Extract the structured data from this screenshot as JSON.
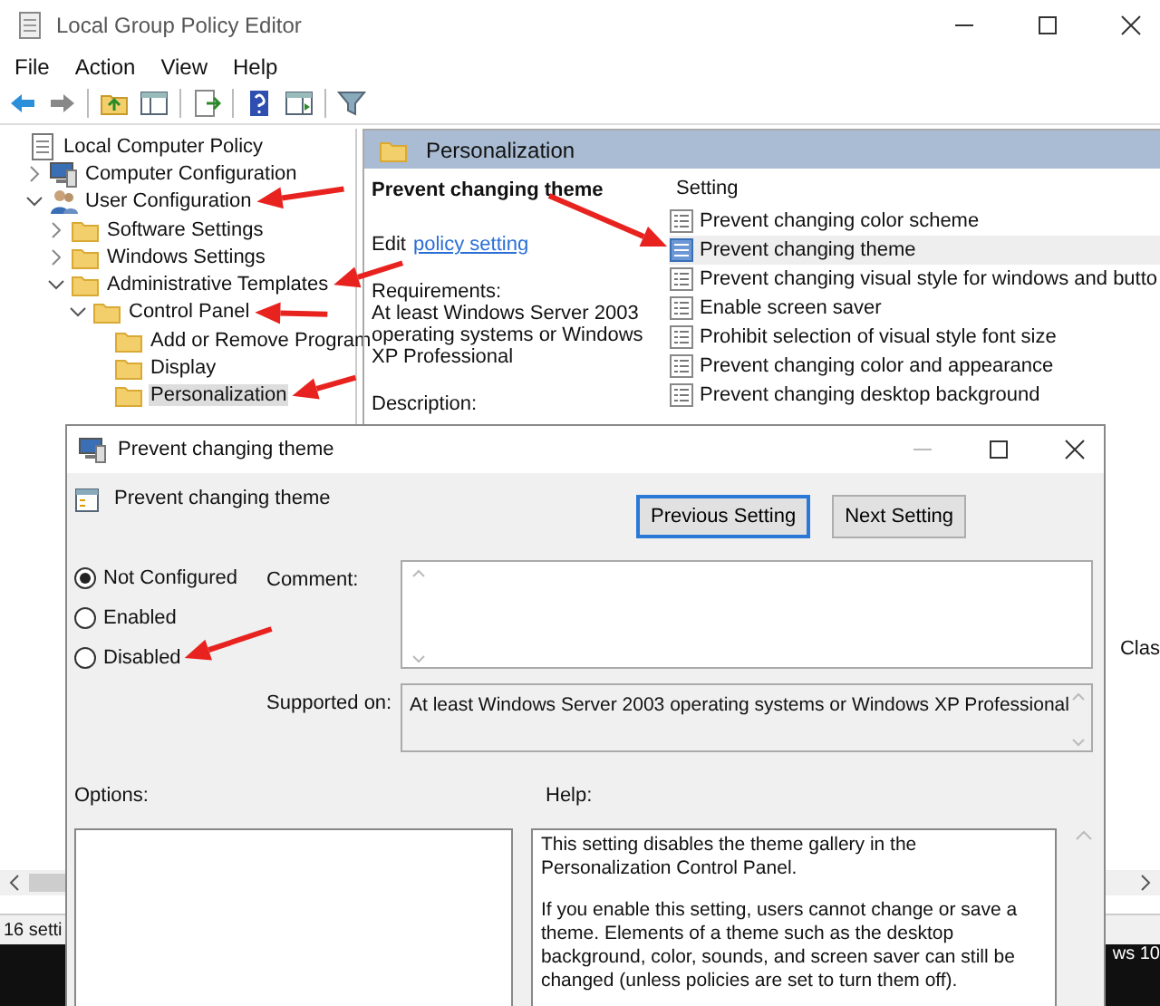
{
  "window": {
    "title": "Local Group Policy Editor"
  },
  "menu": [
    "File",
    "Action",
    "View",
    "Help"
  ],
  "tree": [
    {
      "label": "Local Computer Policy",
      "kind": "policy",
      "selected": false,
      "children": [
        {
          "label": "Computer Configuration",
          "kind": "computer",
          "expanded": false,
          "selected": false
        },
        {
          "label": "User Configuration",
          "kind": "user",
          "expanded": true,
          "selected": false,
          "children": [
            {
              "label": "Software Settings",
              "kind": "folder",
              "expanded": false,
              "selected": false
            },
            {
              "label": "Windows Settings",
              "kind": "folder",
              "expanded": false,
              "selected": false
            },
            {
              "label": "Administrative Templates",
              "kind": "folder",
              "expanded": true,
              "selected": false,
              "children": [
                {
                  "label": "Control Panel",
                  "kind": "folder",
                  "expanded": true,
                  "selected": false,
                  "children": [
                    {
                      "label": "Add or Remove Program",
                      "kind": "folder",
                      "selected": false
                    },
                    {
                      "label": "Display",
                      "kind": "folder",
                      "selected": false
                    },
                    {
                      "label": "Personalization",
                      "kind": "folder",
                      "selected": true
                    }
                  ]
                }
              ]
            }
          ]
        }
      ]
    }
  ],
  "details": {
    "header": "Personalization",
    "title": "Prevent changing theme",
    "edit_prefix": "Edit",
    "edit_link": "policy setting",
    "requirements_label": "Requirements:",
    "requirements": "At least Windows Server 2003 operating systems or Windows XP Professional",
    "description_label": "Description:"
  },
  "settings": {
    "column": "Setting",
    "rows": [
      {
        "name": "Prevent changing color scheme",
        "selected": false
      },
      {
        "name": "Prevent changing theme",
        "selected": true
      },
      {
        "name": "Prevent changing visual style for windows and butto",
        "selected": false
      },
      {
        "name": "Enable screen saver",
        "selected": false
      },
      {
        "name": "Prohibit selection of visual style font size",
        "selected": false
      },
      {
        "name": "Prevent changing color and appearance",
        "selected": false
      },
      {
        "name": "Prevent changing desktop background",
        "selected": false
      }
    ],
    "column_2_fragment": "Clas"
  },
  "status_bar": {
    "text": "16 setti"
  },
  "taskbar": {
    "text": "ws 10"
  },
  "dialog": {
    "title": "Prevent changing theme",
    "heading": "Prevent changing theme",
    "buttons": [
      {
        "label": "Previous Setting",
        "focused": true
      },
      {
        "label": "Next Setting",
        "focused": false
      }
    ],
    "options": [
      {
        "label": "Not Configured",
        "selected": true
      },
      {
        "label": "Enabled",
        "selected": false
      },
      {
        "label": "Disabled",
        "selected": false
      }
    ],
    "comment_label": "Comment:",
    "supported_label": "Supported on:",
    "supported": "At least Windows Server 2003 operating systems or Windows XP Professional",
    "options_label": "Options:",
    "help_label": "Help:",
    "help": [
      "This setting disables the theme gallery in the Personalization Control Panel.",
      "If you enable this setting, users cannot change or save a theme. Elements of a theme such as the desktop background, color, sounds, and screen saver can still be changed (unless policies are set to turn them off)."
    ]
  }
}
